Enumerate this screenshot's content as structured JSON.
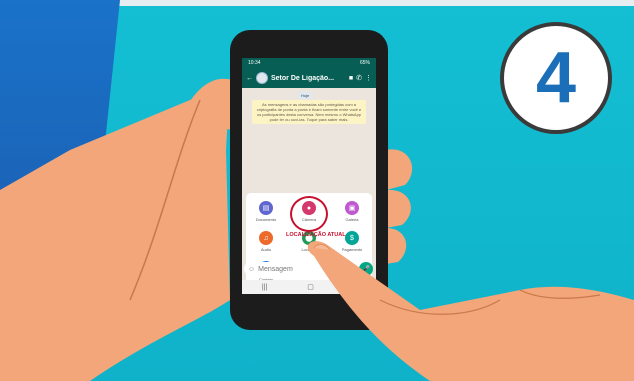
{
  "step_number": "4",
  "phone": {
    "status": {
      "time": "10:34",
      "battery": "65%"
    },
    "chat_title": "Setor De Ligação...",
    "date_chip": "Hoje",
    "encryption_notice": "As mensagens e as chamadas são protegidas com a criptografia de ponta a ponta e ficam somente entre você e os participantes desta conversa. Nem mesmo o WhatsApp pode ler ou ouvi-las. Toque para saber mais.",
    "attach_menu": [
      {
        "label": "Documento",
        "icon": "document-icon",
        "color": "#5f66cd"
      },
      {
        "label": "Câmera",
        "icon": "camera-icon",
        "color": "#d3396d"
      },
      {
        "label": "Galeria",
        "icon": "gallery-icon",
        "color": "#bf59cf"
      },
      {
        "label": "Áudio",
        "icon": "headphones-icon",
        "color": "#ec6a2b"
      },
      {
        "label": "Location",
        "icon": "location-pin-icon",
        "color": "#1f9a58"
      },
      {
        "label": "Pagamento",
        "icon": "payment-icon",
        "color": "#02a698"
      },
      {
        "label": "Contato",
        "icon": "contact-icon",
        "color": "#1f7fd4"
      }
    ],
    "highlight_caption": "LOCALIZAÇÃO ATUAL",
    "message_placeholder": "Mensagem"
  }
}
